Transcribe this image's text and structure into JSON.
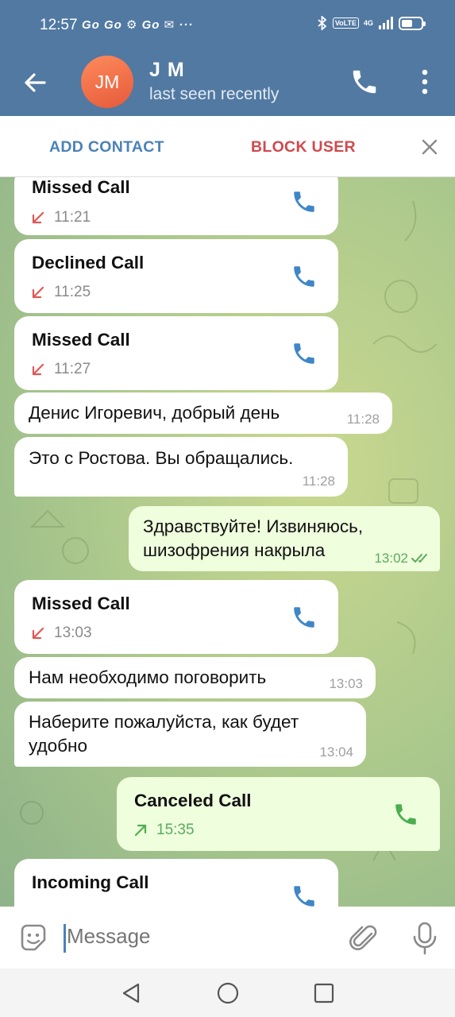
{
  "status_bar": {
    "time": "12:57",
    "notification_text": "Go Go ⚙ Go ✉ ···",
    "volte": "VoLTE",
    "network": "4G",
    "battery_level": 0.55
  },
  "header": {
    "avatar_initials": "JM",
    "contact_name": "J M",
    "contact_status": "last seen recently"
  },
  "action_bar": {
    "add_contact": "ADD CONTACT",
    "block_user": "BLOCK USER"
  },
  "messages": [
    {
      "type": "call",
      "direction": "in",
      "title": "Missed Call",
      "time": "11:21"
    },
    {
      "type": "call",
      "direction": "in",
      "title": "Declined Call",
      "time": "11:25"
    },
    {
      "type": "call",
      "direction": "in",
      "title": "Missed Call",
      "time": "11:27"
    },
    {
      "type": "text",
      "direction": "in",
      "text": "Денис Игоревич, добрый день",
      "time": "11:28"
    },
    {
      "type": "text",
      "direction": "in",
      "text": "Это с Ростова. Вы обращались.",
      "time": "11:28"
    },
    {
      "type": "text",
      "direction": "out",
      "text": "Здравствуйте! Извиняюсь,\nшизофрения накрыла",
      "time": "13:02",
      "read": true
    },
    {
      "type": "call",
      "direction": "in",
      "title": "Missed Call",
      "time": "13:03"
    },
    {
      "type": "text",
      "direction": "in",
      "text": "Нам необходимо поговорить",
      "time": "13:03"
    },
    {
      "type": "text",
      "direction": "in",
      "text": "Наберите пожалуйста, как будет\nудобно",
      "time": "13:04"
    },
    {
      "type": "call",
      "direction": "out",
      "title": "Canceled Call",
      "time": "15:35"
    },
    {
      "type": "call",
      "direction": "in",
      "title": "Incoming Call",
      "time": ""
    }
  ],
  "input": {
    "placeholder": "Message"
  },
  "colors": {
    "header_bg": "#5179a2",
    "add_contact": "#4a82b8",
    "block_user": "#d0494d",
    "outgoing_bubble": "#effedd",
    "missed_arrow": "#e05656",
    "outgoing_arrow": "#4caf50",
    "phone_icon": "#3f86c7",
    "outgoing_phone_icon": "#4caf50"
  }
}
